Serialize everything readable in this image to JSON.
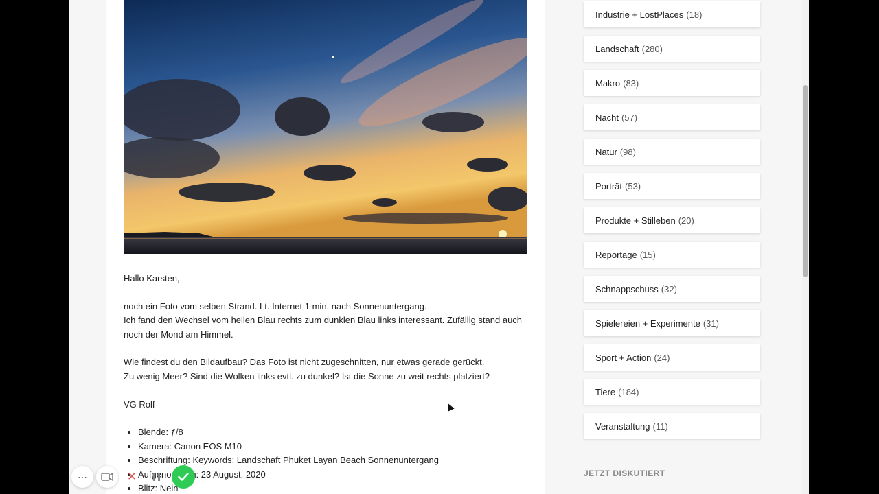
{
  "post": {
    "greeting": "Hallo Karsten,",
    "paragraph1_line1": "noch ein Foto vom selben Strand. Lt. Internet 1 min. nach Sonnenuntergang.",
    "paragraph1_line2": "Ich fand den Wechsel vom hellen Blau rechts zum dunklen Blau links interessant. Zufällig stand auch noch der Mond am Himmel.",
    "paragraph2_line1": "Wie findest du den Bildaufbau? Das Foto ist nicht zugeschnitten, nur etwas gerade gerückt.",
    "paragraph2_line2": "Zu wenig Meer? Sind die Wolken links evtl. zu dunkel? Ist die Sonne zu weit rechts platziert?",
    "signature": "VG Rolf",
    "meta": [
      "Blende: ƒ/8",
      "Kamera: Canon EOS M10",
      "Beschriftung: Keywords: Landschaft Phuket Layan Beach Sonnenuntergang",
      "Aufgenommen: 23 August, 2020",
      "Blitz: Nein"
    ]
  },
  "sidebar": {
    "categories": [
      {
        "name": "Industrie + LostPlaces",
        "count": "(18)"
      },
      {
        "name": "Landschaft",
        "count": "(280)"
      },
      {
        "name": "Makro",
        "count": "(83)"
      },
      {
        "name": "Nacht",
        "count": "(57)"
      },
      {
        "name": "Natur",
        "count": "(98)"
      },
      {
        "name": "Porträt",
        "count": "(53)"
      },
      {
        "name": "Produkte + Stilleben",
        "count": "(20)"
      },
      {
        "name": "Reportage",
        "count": "(15)"
      },
      {
        "name": "Schnappschuss",
        "count": "(32)"
      },
      {
        "name": "Spielereien + Experimente",
        "count": "(31)"
      },
      {
        "name": "Sport + Action",
        "count": "(24)"
      },
      {
        "name": "Tiere",
        "count": "(184)"
      },
      {
        "name": "Veranstaltung",
        "count": "(11)"
      }
    ],
    "next_heading": "JETZT DISKUTIERT"
  },
  "recorder": {
    "icons": [
      "more-icon",
      "camera-icon",
      "close-icon",
      "pause-icon",
      "check-icon"
    ],
    "accent_color": "#2ecc55"
  }
}
